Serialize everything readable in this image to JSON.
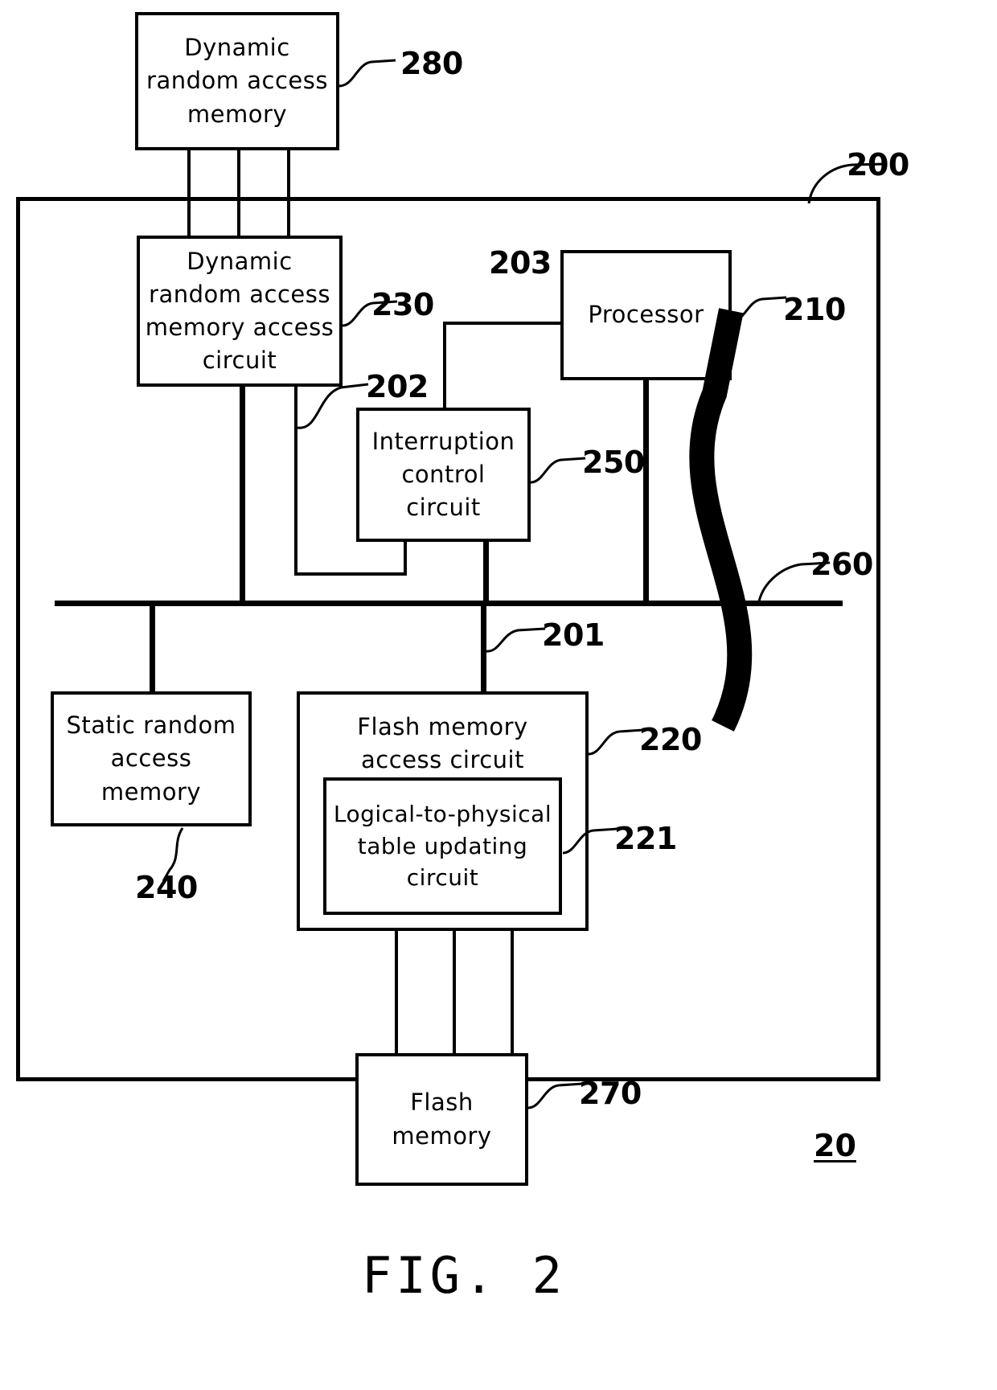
{
  "figure": {
    "caption": "FIG. 2",
    "system_number": "20"
  },
  "blocks": {
    "dram_external": {
      "label": "Dynamic\nrandom access\nmemory",
      "ref": "280"
    },
    "dram_access_circuit": {
      "label": "Dynamic\nrandom access\nmemory access\ncircuit",
      "ref": "230"
    },
    "processor": {
      "label": "Processor",
      "ref": "210"
    },
    "interruption_control_circuit": {
      "label": "Interruption\ncontrol\ncircuit",
      "ref": "250"
    },
    "sram": {
      "label": "Static random\naccess memory",
      "ref": "240"
    },
    "flash_access_circuit": {
      "label": "Flash memory\naccess circuit",
      "ref": "220"
    },
    "l2p_table_updating_circuit": {
      "label": "Logical-to-physical\ntable updating\ncircuit",
      "ref": "221"
    },
    "flash_memory": {
      "label": "Flash\nmemory",
      "ref": "270"
    }
  },
  "refs": {
    "system_on_chip": "200",
    "bus": "260",
    "signal_201": "201",
    "signal_202": "202",
    "signal_203": "203"
  },
  "colors": {
    "line": "#000000",
    "background": "#ffffff"
  }
}
